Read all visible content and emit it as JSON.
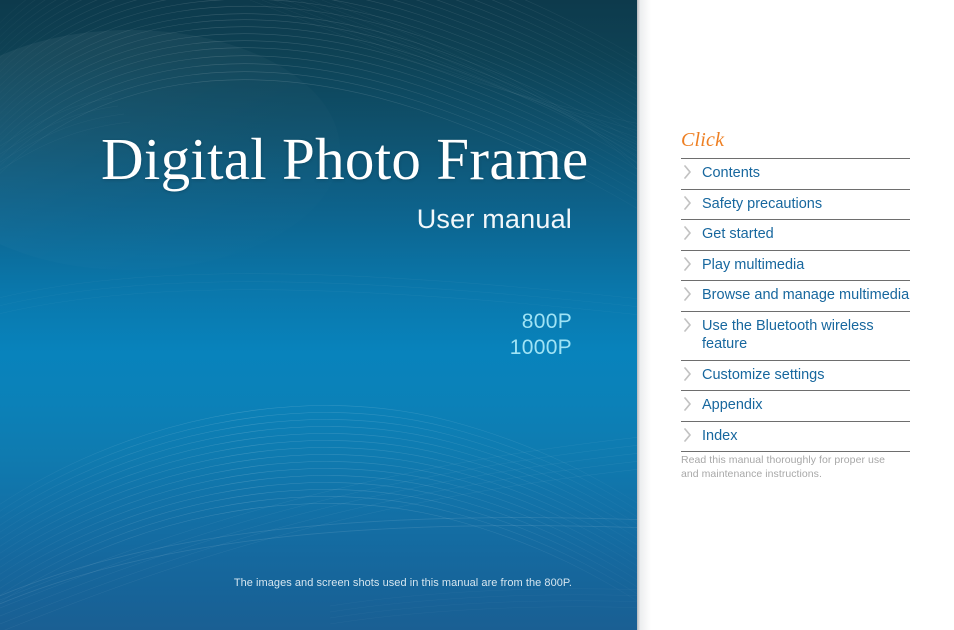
{
  "cover": {
    "title": "Digital Photo Frame",
    "subtitle": "User manual",
    "model_primary": "800P",
    "model_secondary": "1000P",
    "note": "The images and screen shots used in this manual are from the 800P.",
    "colors": {
      "gradient_top": "#0d3a4c",
      "gradient_mid": "#0883bc",
      "gradient_bottom": "#1a5f93",
      "model_text": "#9fe3f5"
    }
  },
  "nav": {
    "heading": "Click",
    "heading_color": "#ee7f22",
    "link_color": "#17679e",
    "chevron_icon": "chevron-right-icon",
    "items": [
      {
        "label": "Contents"
      },
      {
        "label": "Safety precautions"
      },
      {
        "label": "Get started"
      },
      {
        "label": "Play multimedia"
      },
      {
        "label": "Browse and manage multimedia"
      },
      {
        "label": "Use the Bluetooth wireless feature"
      },
      {
        "label": "Customize settings"
      },
      {
        "label": "Appendix"
      },
      {
        "label": "Index"
      }
    ],
    "footnote": "Read this manual thoroughly for proper use and maintenance instructions."
  }
}
